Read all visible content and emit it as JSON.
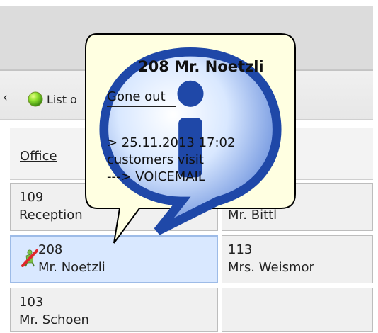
{
  "toolbar": {
    "arrow_icon": "left-chevron",
    "status_icon": "green-status-light",
    "list_label": "List o"
  },
  "table": {
    "header": {
      "office_label": "Office"
    },
    "cells": [
      {
        "ext": "109",
        "name": "Reception"
      },
      {
        "ext": "",
        "name": "Mr. Bittl"
      },
      {
        "ext": "208",
        "name": "Mr. Noetzli",
        "icon": "person-away-icon"
      },
      {
        "ext": "113",
        "name": "Mrs. Weismor"
      },
      {
        "ext": "103",
        "name": "Mr. Schoen"
      }
    ]
  },
  "callout": {
    "title": "208 Mr. Noetzli",
    "status": "Gone out",
    "line1": "> 25.11.2013 17:02",
    "line2": "customers visit",
    "line3": " ---> VOICEMAIL"
  }
}
